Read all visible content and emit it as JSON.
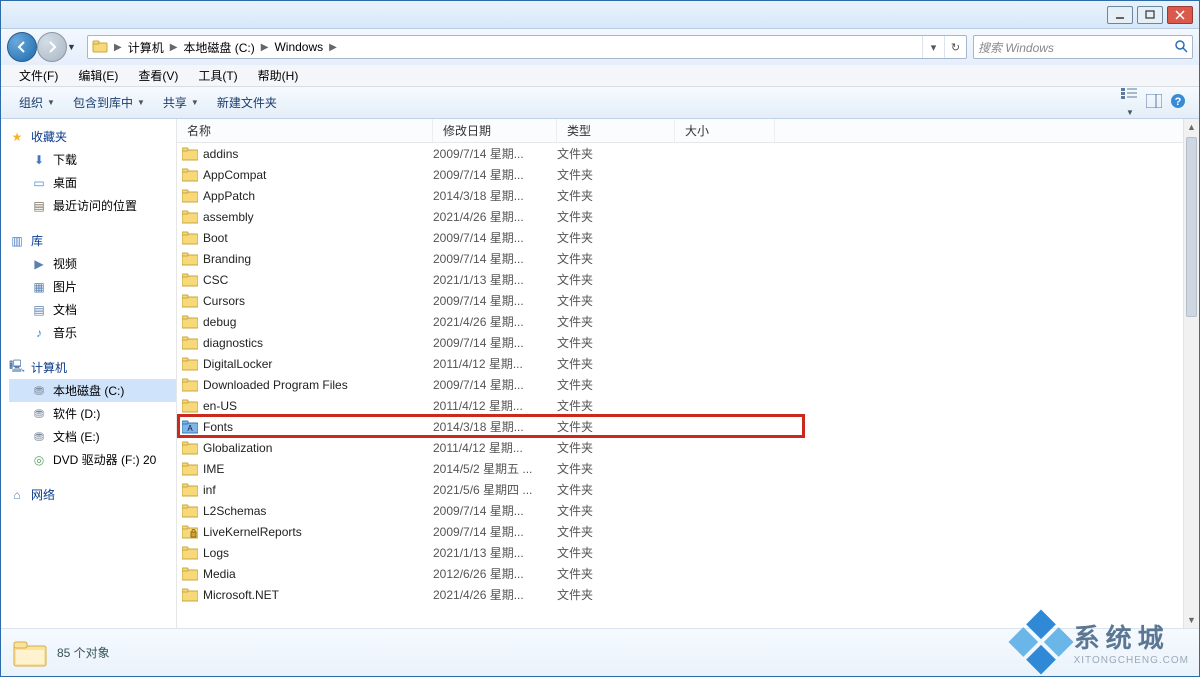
{
  "titlebar": {
    "min": "",
    "max": "",
    "close": ""
  },
  "nav": {
    "back": "←",
    "forward": "→",
    "crumbs": [
      "计算机",
      "本地磁盘 (C:)",
      "Windows"
    ],
    "refresh": "↻"
  },
  "search": {
    "placeholder": "搜索 Windows"
  },
  "menubar": [
    "文件(F)",
    "编辑(E)",
    "查看(V)",
    "工具(T)",
    "帮助(H)"
  ],
  "toolbar": {
    "organize": "组织",
    "include": "包含到库中",
    "share": "共享",
    "newfolder": "新建文件夹"
  },
  "navpane": {
    "favorites": {
      "label": "收藏夹",
      "items": [
        "下载",
        "桌面",
        "最近访问的位置"
      ]
    },
    "libraries": {
      "label": "库",
      "items": [
        "视频",
        "图片",
        "文档",
        "音乐"
      ]
    },
    "computer": {
      "label": "计算机",
      "items": [
        "本地磁盘 (C:)",
        "软件 (D:)",
        "文档 (E:)",
        "DVD 驱动器 (F:) 20"
      ]
    },
    "network": {
      "label": "网络"
    }
  },
  "columns": {
    "name": "名称",
    "date": "修改日期",
    "type": "类型",
    "size": "大小"
  },
  "files": [
    {
      "name": "addins",
      "date": "2009/7/14 星期...",
      "type": "文件夹"
    },
    {
      "name": "AppCompat",
      "date": "2009/7/14 星期...",
      "type": "文件夹"
    },
    {
      "name": "AppPatch",
      "date": "2014/3/18 星期...",
      "type": "文件夹"
    },
    {
      "name": "assembly",
      "date": "2021/4/26 星期...",
      "type": "文件夹"
    },
    {
      "name": "Boot",
      "date": "2009/7/14 星期...",
      "type": "文件夹"
    },
    {
      "name": "Branding",
      "date": "2009/7/14 星期...",
      "type": "文件夹"
    },
    {
      "name": "CSC",
      "date": "2021/1/13 星期...",
      "type": "文件夹"
    },
    {
      "name": "Cursors",
      "date": "2009/7/14 星期...",
      "type": "文件夹"
    },
    {
      "name": "debug",
      "date": "2021/4/26 星期...",
      "type": "文件夹"
    },
    {
      "name": "diagnostics",
      "date": "2009/7/14 星期...",
      "type": "文件夹"
    },
    {
      "name": "DigitalLocker",
      "date": "2011/4/12 星期...",
      "type": "文件夹"
    },
    {
      "name": "Downloaded Program Files",
      "date": "2009/7/14 星期...",
      "type": "文件夹"
    },
    {
      "name": "en-US",
      "date": "2011/4/12 星期...",
      "type": "文件夹"
    },
    {
      "name": "Fonts",
      "date": "2014/3/18 星期...",
      "type": "文件夹",
      "highlight": true,
      "special": "fonts"
    },
    {
      "name": "Globalization",
      "date": "2011/4/12 星期...",
      "type": "文件夹"
    },
    {
      "name": "IME",
      "date": "2014/5/2 星期五 ...",
      "type": "文件夹"
    },
    {
      "name": "inf",
      "date": "2021/5/6 星期四 ...",
      "type": "文件夹"
    },
    {
      "name": "L2Schemas",
      "date": "2009/7/14 星期...",
      "type": "文件夹"
    },
    {
      "name": "LiveKernelReports",
      "date": "2009/7/14 星期...",
      "type": "文件夹",
      "special": "locked"
    },
    {
      "name": "Logs",
      "date": "2021/1/13 星期...",
      "type": "文件夹"
    },
    {
      "name": "Media",
      "date": "2012/6/26 星期...",
      "type": "文件夹"
    },
    {
      "name": "Microsoft.NET",
      "date": "2021/4/26 星期...",
      "type": "文件夹"
    }
  ],
  "status": {
    "text": "85 个对象"
  },
  "watermark": {
    "cn": "系统城",
    "en": "XITONGCHENG.COM"
  }
}
